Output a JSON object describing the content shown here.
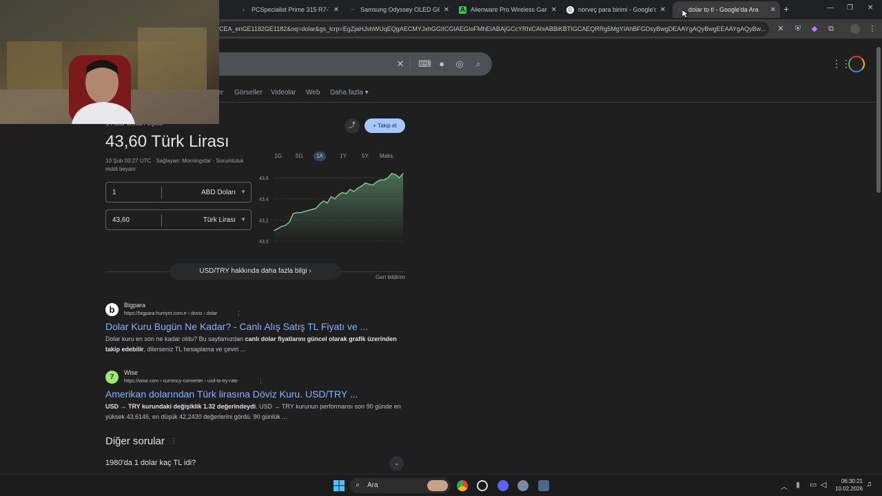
{
  "browser": {
    "tabs": [
      {
        "title": "PCSpecialist Prime 315 R7-7/16",
        "active": false
      },
      {
        "title": "Samsung Odyssey OLED G6 G6",
        "active": false
      },
      {
        "title": "Alienware Pro Wireless Gaming",
        "active": false
      },
      {
        "title": "norveç para birimi - Google'da",
        "active": false
      },
      {
        "title": "dolar to tl - Google'da Ara",
        "active": true
      }
    ],
    "new_tab_label": "+",
    "url": "CEA_enGE1182GE1182&oq=dolar&gs_lcrp=EgZjaHJvbWUqEQgAECMYJxhGGIICGIAEGIoFMhEIABAjGCcYRhiCAhiABBiKBTIGCAEQRRg5MgYIAhBFGDsyBwgDEAAYgAQyBwgEEAAYgAQyBw..."
  },
  "search": {
    "nav_tabs": [
      "ler",
      "Görseller",
      "Videolar",
      "Web",
      "Daha fazla"
    ]
  },
  "currency": {
    "equals_label": "1 ABD Doları eşittir",
    "result": "43,60 Türk Lirası",
    "meta_line1": "10 Şub 03:27 UTC · Sağlayan: Morningstar · Sorumluluk",
    "meta_line2": "reddi beyanı",
    "share_label": "",
    "follow_label": "+ Takip et",
    "from_value": "1",
    "from_currency": "ABD Doları",
    "to_value": "43,60",
    "to_currency": "Türk Lirası",
    "ranges": [
      "1G",
      "5G",
      "1A",
      "1Y",
      "5Y",
      "Maks."
    ],
    "selected_range": "1A",
    "more_info": "USD/TRY hakkında daha fazla bilgi",
    "feedback": "Geri bildirim"
  },
  "chart_data": {
    "type": "area",
    "y_ticks": [
      "43,6",
      "43,4",
      "43,2",
      "43,0"
    ],
    "ylim": [
      43.0,
      43.6
    ],
    "values": [
      43.1,
      43.12,
      43.14,
      43.15,
      43.18,
      43.26,
      43.27,
      43.27,
      43.28,
      43.29,
      43.3,
      43.31,
      43.35,
      43.38,
      43.36,
      43.42,
      43.4,
      43.44,
      43.46,
      43.45,
      43.49,
      43.47,
      43.5,
      43.52,
      43.55,
      43.54,
      43.53,
      43.56,
      43.58,
      43.58,
      43.6,
      43.64,
      43.63,
      43.6,
      43.64
    ]
  },
  "results": [
    {
      "site": "Bigpara",
      "url": "https://bigpara.hurriyet.com.tr › doviz › dolar",
      "title": "Dolar Kuru Bugün Ne Kadar? - Canlı Alış Satış TL Fiyatı ve ...",
      "snippet_a": "Dolar kuru en son ne kadar oldu? Bu sayfamızdan ",
      "snippet_b": "canlı dolar fiyatlarını güncel olarak grafik üzerinden takip edebilir",
      "snippet_c": ", dilerseniz TL hesaplama ve çeviri ..."
    },
    {
      "site": "Wise",
      "url": "https://wise.com › currency-converter › usd-to-try-rate",
      "title": "Amerikan dolarından Türk lirasına Döviz Kuru. USD/TRY ...",
      "snippet_a": "",
      "snippet_b": "USD → TRY kurundaki değişiklik 1.32 değerindeydi",
      "snippet_c": ". USD → TRY kurunun performansı son 90 günde en yüksek 43,6146, en düşük 42,2430 değerlerini gördü. 90 günlük ..."
    }
  ],
  "other_questions": {
    "heading": "Diğer sorular",
    "q1": "1980'da 1 dolar kaç TL idi?"
  },
  "taskbar": {
    "search_placeholder": "Ara",
    "time": "06:30:21",
    "date": "10.02.2026"
  }
}
